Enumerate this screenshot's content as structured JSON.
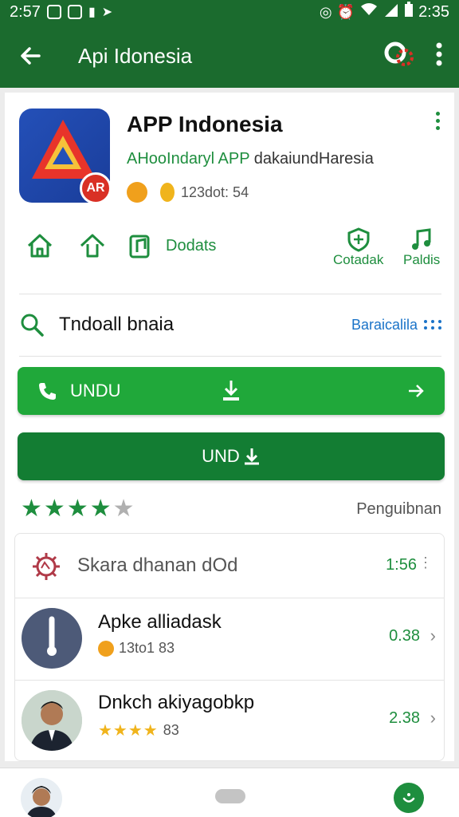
{
  "status_bar": {
    "time_left": "2:57",
    "time_right": "2:35"
  },
  "app_bar": {
    "title": "Api Idonesia"
  },
  "app": {
    "name": "APP Indonesia",
    "developer_highlight": "AHooIndaryl APP",
    "developer_rest": " dakaiundHaresia",
    "meta_text": "123dot: 54",
    "icon_badge": "AR"
  },
  "quick_actions": [
    {
      "label": "",
      "icon": "home-icon"
    },
    {
      "label": "",
      "icon": "upload-icon"
    },
    {
      "label": "Dodats",
      "icon": "music-note-icon"
    },
    {
      "label": "Cotadak",
      "icon": "shield-icon"
    },
    {
      "label": "Paldis",
      "icon": "music-icon"
    }
  ],
  "search": {
    "query": "Tndoall bnaia",
    "link": "Baraicalila"
  },
  "buttons": {
    "primary_label": "UNDU",
    "secondary_label": "UND"
  },
  "rating": {
    "stars": 4,
    "max": 5,
    "label": "Penguibnan"
  },
  "list": [
    {
      "title": "Skara dhanan dOd",
      "value": "1:56",
      "trail": "more-icon"
    },
    {
      "title": "Apke alliadask",
      "sub": "13to1 83",
      "value": "0.38",
      "trail": "chevron-right-icon"
    },
    {
      "title": "Dnkch akiyagobkp",
      "sub": "83",
      "value": "2.38",
      "trail": "chevron-right-icon"
    }
  ],
  "colors": {
    "primary": "#1b6b2e",
    "accent": "#1e8e3e",
    "button_light": "#20a83a",
    "button_dark": "#137d33",
    "link": "#1a73c8"
  }
}
